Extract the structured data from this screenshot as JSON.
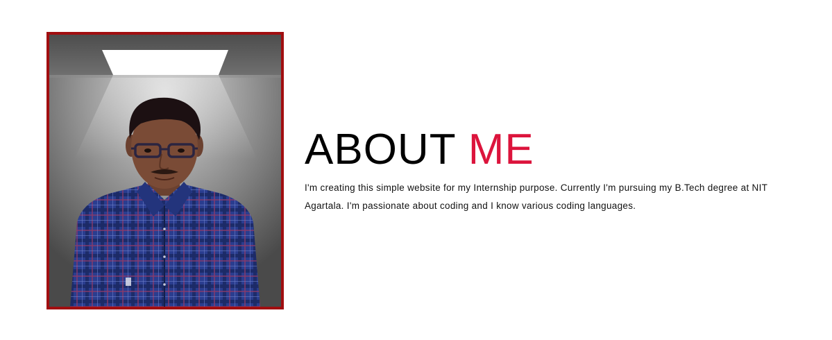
{
  "about": {
    "title_main": "ABOUT",
    "title_accent": "ME",
    "description": "I'm creating this simple website for my Internship purpose. Currently I'm pursuing my B.Tech degree at NIT Agartala. I'm passionate about coding and I know various coding languages.",
    "accent_color": "#dc143c",
    "frame_color": "#a10e10"
  },
  "profile_photo": {
    "icon": "profile-photo"
  }
}
